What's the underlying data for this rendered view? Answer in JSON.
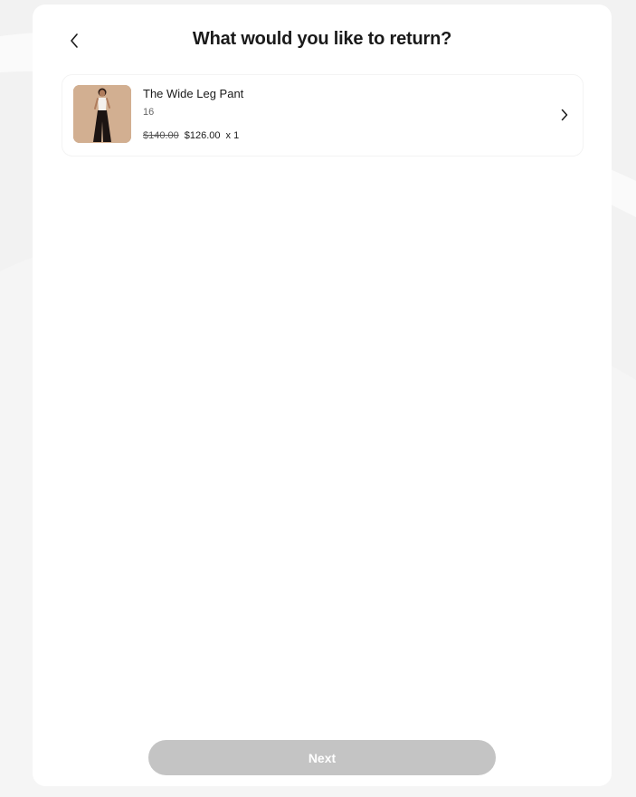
{
  "header": {
    "title": "What would you like to return?",
    "back_icon": "chevron-left-icon"
  },
  "items": [
    {
      "name": "The Wide Leg Pant",
      "size": "16",
      "original_price": "$140.00",
      "sale_price": "$126.00",
      "quantity": "x 1",
      "chevron_icon": "chevron-right-icon"
    }
  ],
  "footer": {
    "next_label": "Next",
    "next_enabled": false
  },
  "colors": {
    "page_background": "#f2f2f2",
    "panel_background": "#ffffff",
    "button_disabled": "#c4c4c4",
    "thumb_background": "#c9a487"
  }
}
